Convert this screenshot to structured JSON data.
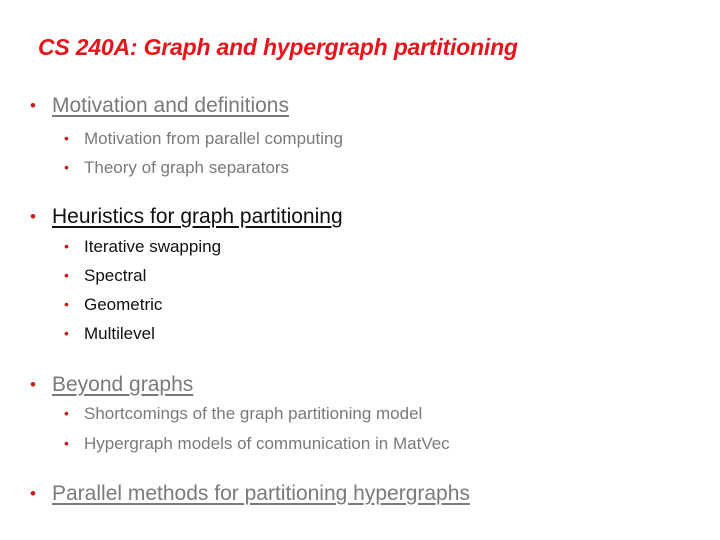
{
  "slide": {
    "title": "CS 240A:  Graph and hypergraph partitioning",
    "bullet_glyph": "•",
    "sections": [
      {
        "label": "Motivation and definitions",
        "state": "dimmed",
        "items": [
          "Motivation from parallel computing",
          "Theory of graph separators"
        ]
      },
      {
        "label": "Heuristics for graph partitioning",
        "state": "active",
        "items": [
          "Iterative swapping",
          "Spectral",
          "Geometric",
          "Multilevel"
        ]
      },
      {
        "label": "Beyond graphs",
        "state": "dimmed",
        "items": [
          "Shortcomings of the graph partitioning model",
          "Hypergraph models of communication in MatVec"
        ]
      },
      {
        "label": "Parallel methods for partitioning hypergraphs",
        "state": "dimmed",
        "items": []
      }
    ]
  },
  "colors": {
    "title": "#e8141c",
    "bullet": "#cc1a1a",
    "dimmed_text": "#7a7a7a",
    "active_text": "#111111"
  }
}
